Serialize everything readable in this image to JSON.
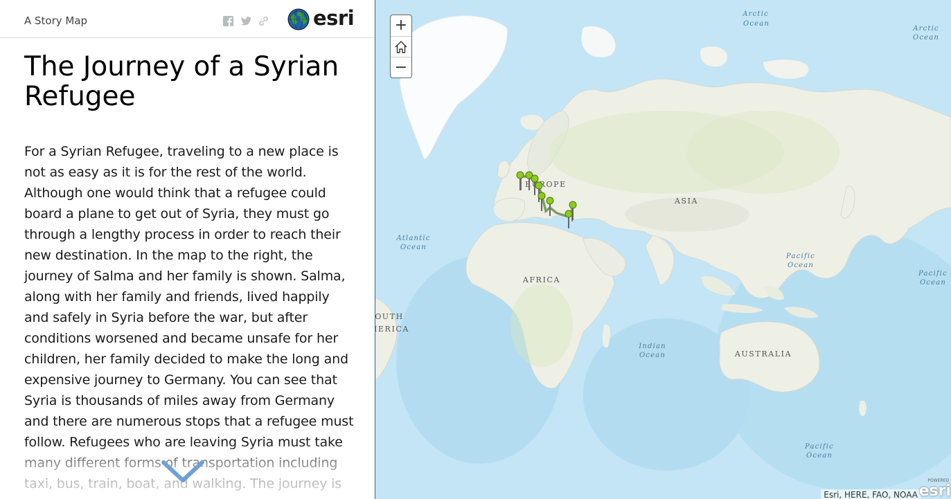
{
  "header": {
    "title": "A Story Map",
    "share_icons": [
      "facebook-icon",
      "twitter-icon",
      "link-icon"
    ],
    "logo_text": "esri"
  },
  "story": {
    "title": "The Journey of a Syrian Refugee",
    "body": "For a Syrian Refugee, traveling to a new place is not as easy as it is for the rest of the world. Although one would think that a refugee could board a plane to get out of Syria, they must go through a lengthy process in order to reach their new destination. In the map to the right, the journey of Salma and her family is shown. Salma, along with her family and friends, lived happily and safely in Syria before the war, but after conditions worsened and became unsafe for her children, her family decided to make the long and expensive journey to Germany. You can see that Syria is thousands of miles away from Germany and there are numerous stops that a refugee must follow. Refugees who are leaving Syria must take many different forms of transportation including taxi, bus, train, boat, and walking. The journey is"
  },
  "map": {
    "zoom_in_label": "+",
    "zoom_out_label": "−",
    "home_icon": "home-icon",
    "labels": {
      "arctic_1": [
        "Arctic",
        "Ocean"
      ],
      "arctic_2": [
        "Arctic",
        "Ocean"
      ],
      "europe": "EUROPE",
      "asia": "ASIA",
      "atlantic": [
        "Atlantic",
        "Ocean"
      ],
      "africa": "AFRICA",
      "pacific_1": [
        "Pacific",
        "Ocean"
      ],
      "pacific_2": [
        "Pacific",
        "Ocean"
      ],
      "pacific_3": [
        "Pacific",
        "Ocean"
      ],
      "indian": [
        "Indian",
        "Ocean"
      ],
      "australia": "AUSTRALIA",
      "south_america": [
        "OUTH",
        "MERICA"
      ]
    },
    "attribution": "Esri, HERE, FAO, NOAA",
    "powered_small": "POWERED",
    "powered_big": "esri",
    "colors": {
      "ocean": "#bfe3f4",
      "land": "#eef0e6",
      "ice": "#fbfcfd",
      "route": "#6f9e3a",
      "pin": "#8ccc1e"
    }
  }
}
